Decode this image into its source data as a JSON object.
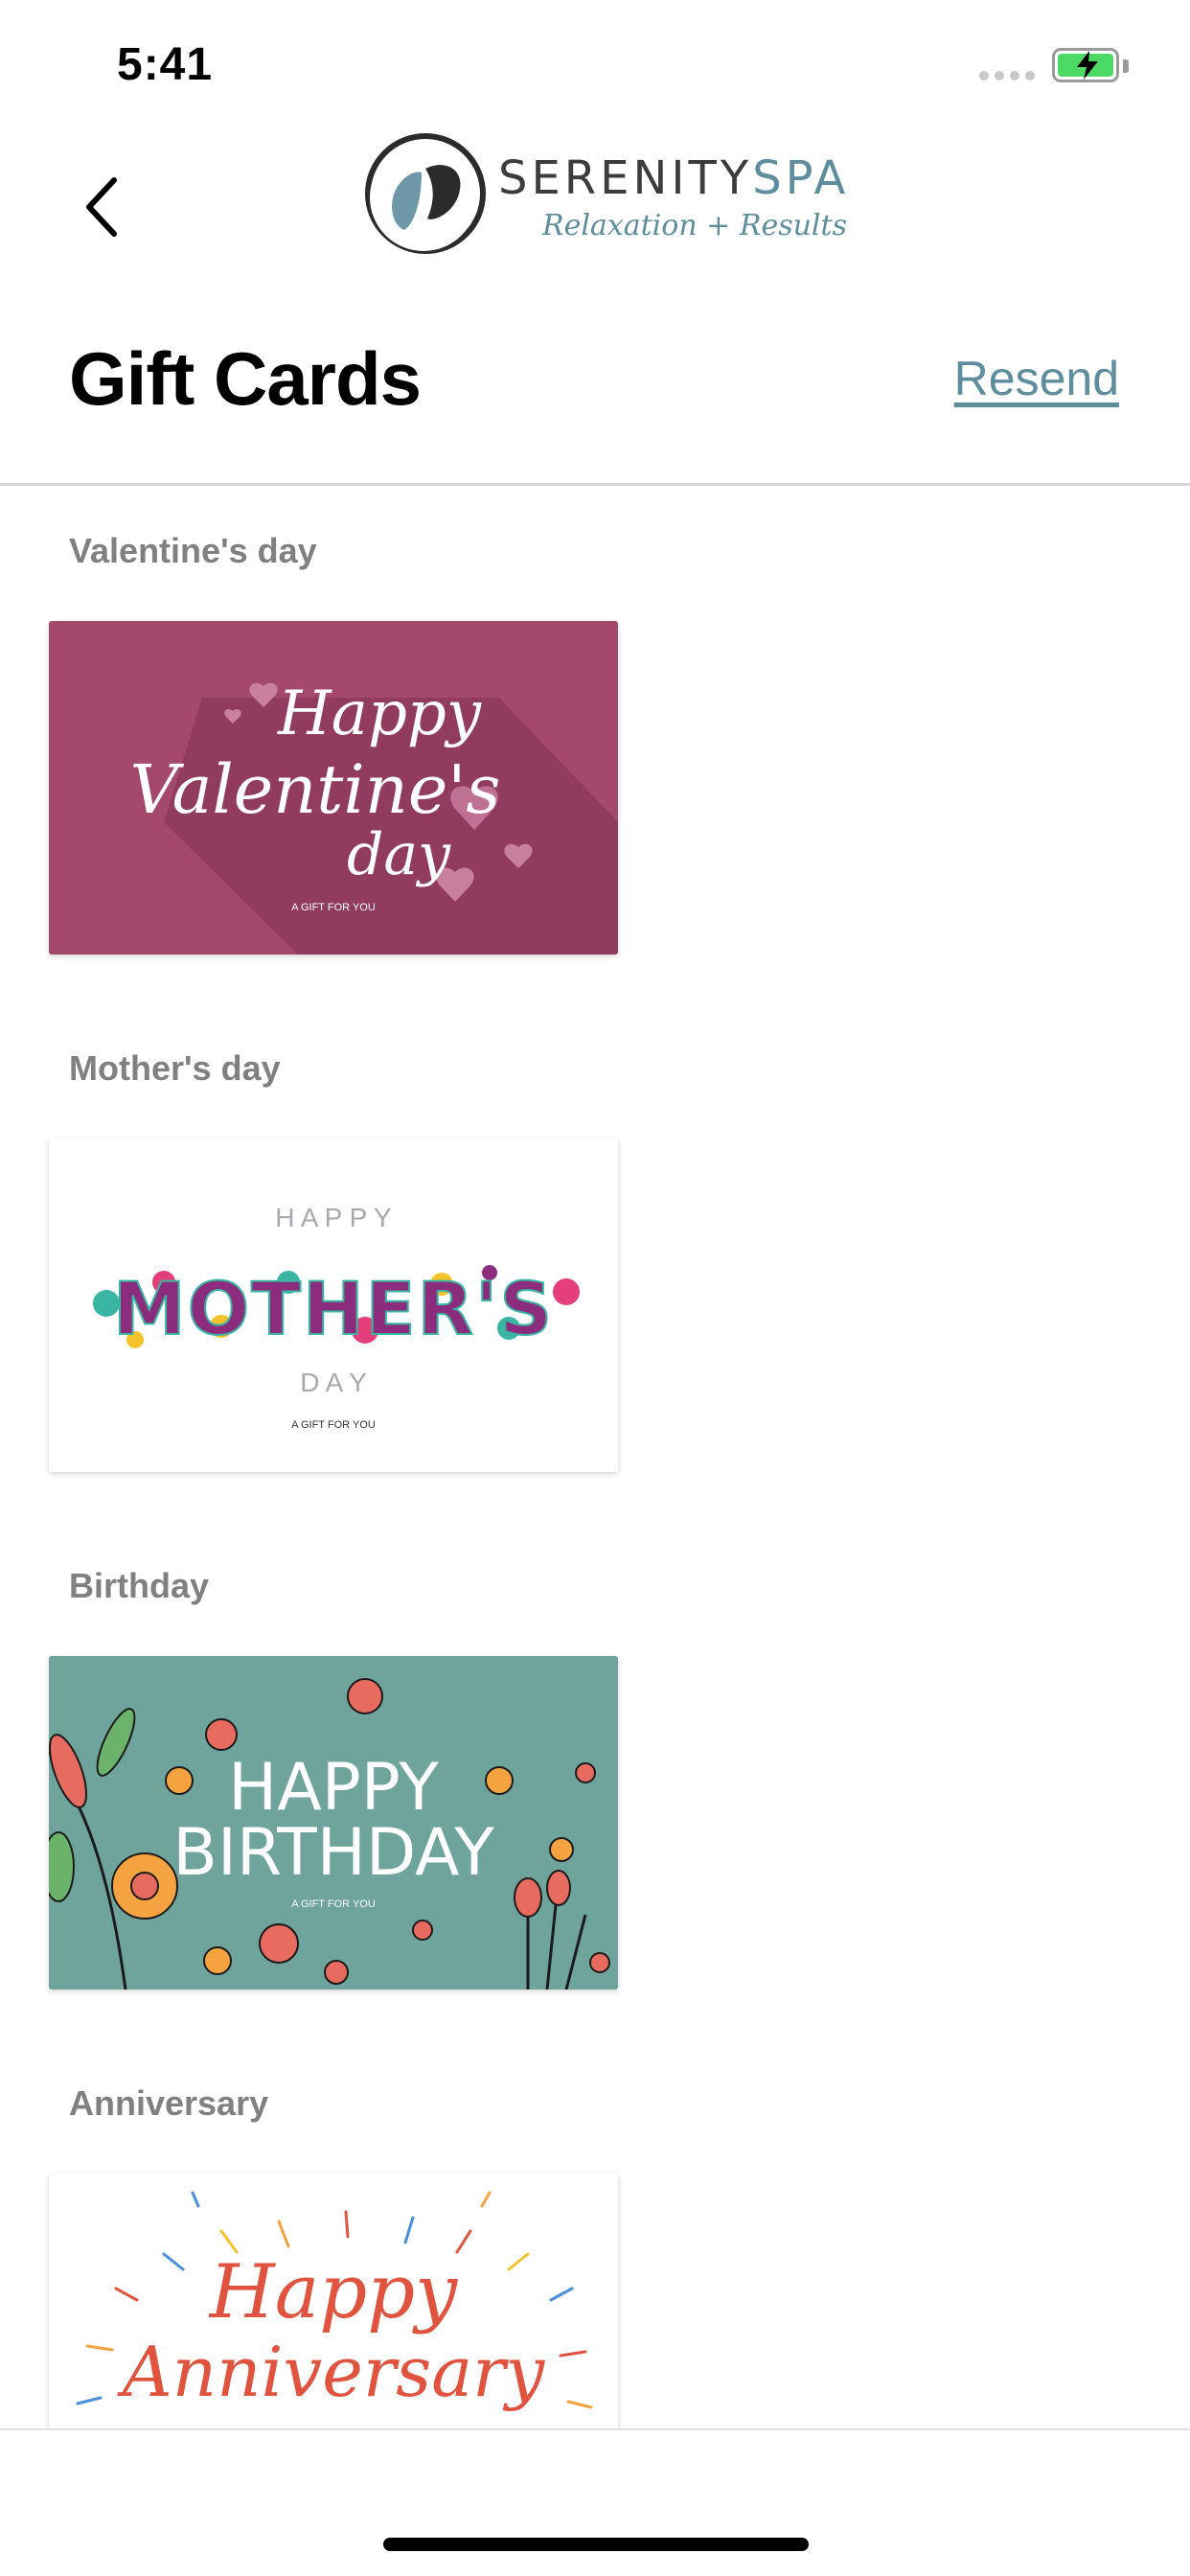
{
  "status_bar": {
    "time": "5:41"
  },
  "header": {
    "logo_name_part1": "SERENITY",
    "logo_name_part2": "SPA",
    "logo_tagline": "Relaxation + Results"
  },
  "page": {
    "title": "Gift Cards",
    "resend_label": "Resend"
  },
  "sections": [
    {
      "title": "Valentine's day",
      "card_text": [
        "Happy",
        "Valentine's",
        "day"
      ],
      "card_subtitle": "A GIFT FOR YOU"
    },
    {
      "title": "Mother's day",
      "card_text": [
        "H A P P Y",
        "MOTHER'S",
        "D A Y"
      ],
      "card_subtitle": "A GIFT FOR YOU"
    },
    {
      "title": "Birthday",
      "card_text": [
        "HAPPY",
        "BIRTHDAY"
      ],
      "card_subtitle": "A GIFT FOR YOU"
    },
    {
      "title": "Anniversary",
      "card_text": [
        "Happy",
        "Anniversary"
      ]
    }
  ],
  "colors": {
    "accent": "#5e8e9e",
    "valentine_bg": "#a4486c",
    "birthday_bg": "#6fa49c",
    "anniversary_text": "#e0533f"
  }
}
